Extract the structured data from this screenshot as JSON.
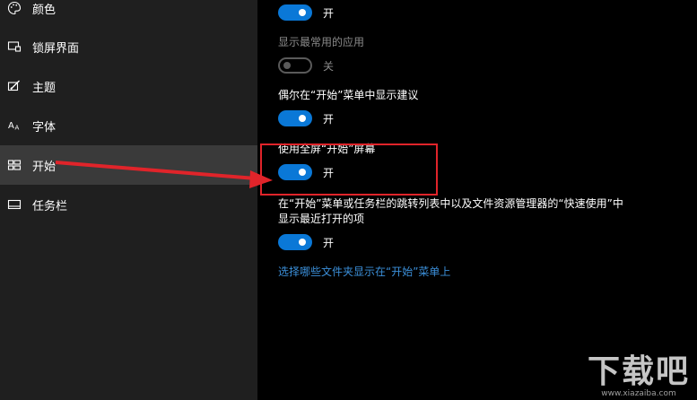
{
  "sidebar": {
    "items": [
      {
        "label": "颜色",
        "icon": "palette-icon"
      },
      {
        "label": "锁屏界面",
        "icon": "lock-screen-icon"
      },
      {
        "label": "主题",
        "icon": "theme-brush-icon"
      },
      {
        "label": "字体",
        "icon": "font-icon"
      },
      {
        "label": "开始",
        "icon": "start-tiles-icon",
        "selected": true
      },
      {
        "label": "任务栏",
        "icon": "taskbar-icon"
      }
    ]
  },
  "main": {
    "settings": [
      {
        "label": "",
        "state": "开",
        "on": true
      },
      {
        "label": "显示最常用的应用",
        "state": "关",
        "on": false
      },
      {
        "label": "偶尔在“开始”菜单中显示建议",
        "state": "开",
        "on": true
      },
      {
        "label": "使用全屏“开始”屏幕",
        "state": "开",
        "on": true
      },
      {
        "label_line1": "在“开始”菜单或任务栏的跳转列表中以及文件资源管理器的“快速使用”中",
        "label_line2": "显示最近打开的项",
        "state": "开",
        "on": true
      }
    ],
    "link": "选择哪些文件夹显示在“开始”菜单上"
  },
  "watermark": {
    "logo": "下载吧",
    "url": "www.xiazaiba.com"
  },
  "colors": {
    "accent": "#0a78d7",
    "annotation": "#e0242a",
    "link": "#3b8fd9"
  }
}
